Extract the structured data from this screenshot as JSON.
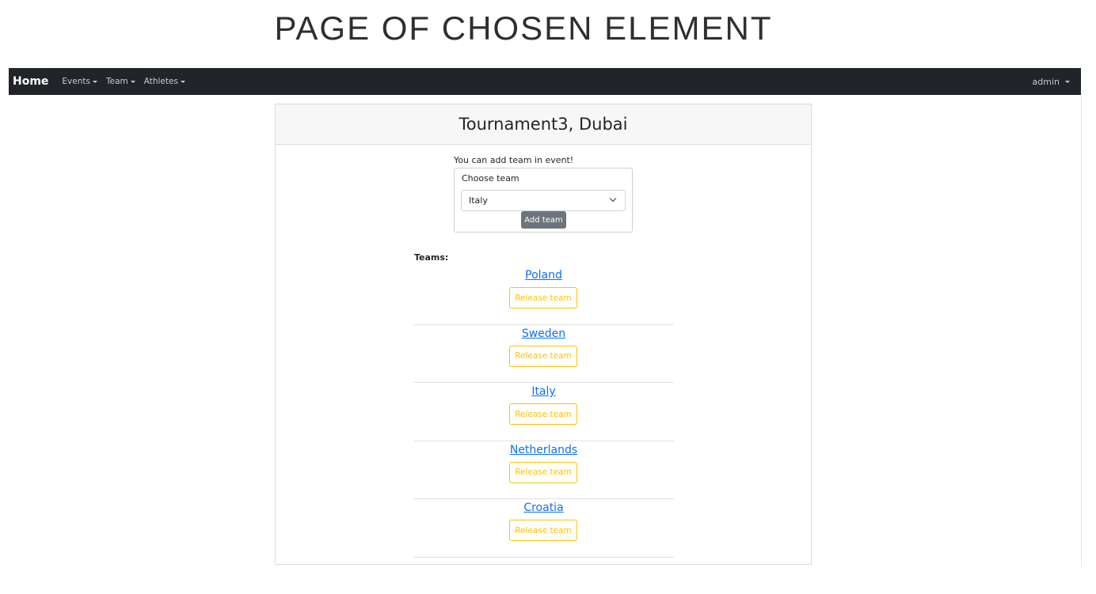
{
  "caption": "PAGE OF CHOSEN ELEMENT",
  "navbar": {
    "brand": "Home",
    "items": [
      {
        "label": "Events"
      },
      {
        "label": "Team"
      },
      {
        "label": "Athletes"
      }
    ],
    "user": "admin"
  },
  "card": {
    "title": "Tournament3, Dubai",
    "add_prompt": "You can add team in event!",
    "form": {
      "label": "Choose team",
      "selected": "Italy",
      "submit": "Add team"
    },
    "teams_label": "Teams:",
    "teams": [
      {
        "name": "Poland",
        "action": "Release team"
      },
      {
        "name": "Sweden",
        "action": "Release team"
      },
      {
        "name": "Italy",
        "action": "Release team"
      },
      {
        "name": "Netherlands",
        "action": "Release team"
      },
      {
        "name": "Croatia",
        "action": "Release team"
      }
    ]
  },
  "colors": {
    "navbar": "#212529",
    "link": "#0d6efd",
    "warning": "#ffc107",
    "secondary": "#6c757d"
  }
}
